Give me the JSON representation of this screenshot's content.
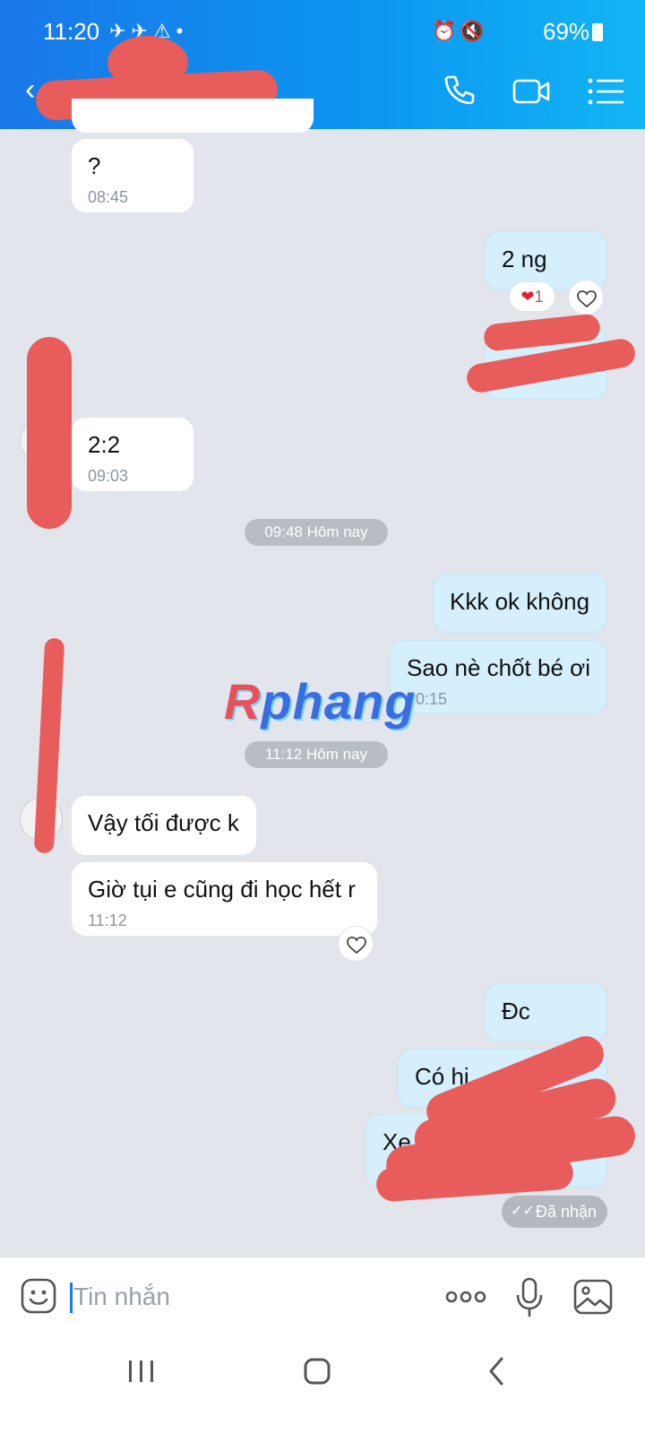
{
  "status_bar": {
    "time": "11:20",
    "left_icons": "✈✈⚠•",
    "right_icons": "⏰🔇",
    "battery": "69%"
  },
  "header": {
    "contact_name": "",
    "icons": [
      "back-icon",
      "call-icon",
      "video-icon",
      "menu-icon"
    ]
  },
  "messages": [
    {
      "side": "in",
      "text": "?",
      "time": "08:45"
    },
    {
      "side": "out",
      "text": "2 ng",
      "reaction": "❤",
      "reaction_count": "1"
    },
    {
      "side": "out",
      "text": "",
      "time": ""
    },
    {
      "side": "in",
      "text": "2:2",
      "time": "09:03"
    },
    {
      "side": "out",
      "text": "Kkk ok không"
    },
    {
      "side": "out",
      "text": "Sao nè chốt bé ơi",
      "time": "10:15"
    },
    {
      "side": "in",
      "text": "Vậy tối được k"
    },
    {
      "side": "in",
      "text": "Giờ tụi e cũng đi học hết r",
      "time": "11:12"
    },
    {
      "side": "out",
      "text": "Đc"
    },
    {
      "side": "out",
      "text": "Có hi..."
    },
    {
      "side": "out",
      "text": "Xe..."
    }
  ],
  "dividers": [
    "09:48 Hôm nay",
    "11:12 Hôm nay"
  ],
  "watermark": {
    "r": "R",
    "rest": "phang"
  },
  "received_status": "Đã nhận",
  "received_check": "✓✓",
  "composer": {
    "placeholder": "Tin nhắn"
  },
  "colors": {
    "header_start": "#1a77e8",
    "header_end": "#12b5f5",
    "outgoing_bubble": "#d5effc",
    "incoming_bubble": "#ffffff",
    "chat_background": "#e2e6ec"
  }
}
